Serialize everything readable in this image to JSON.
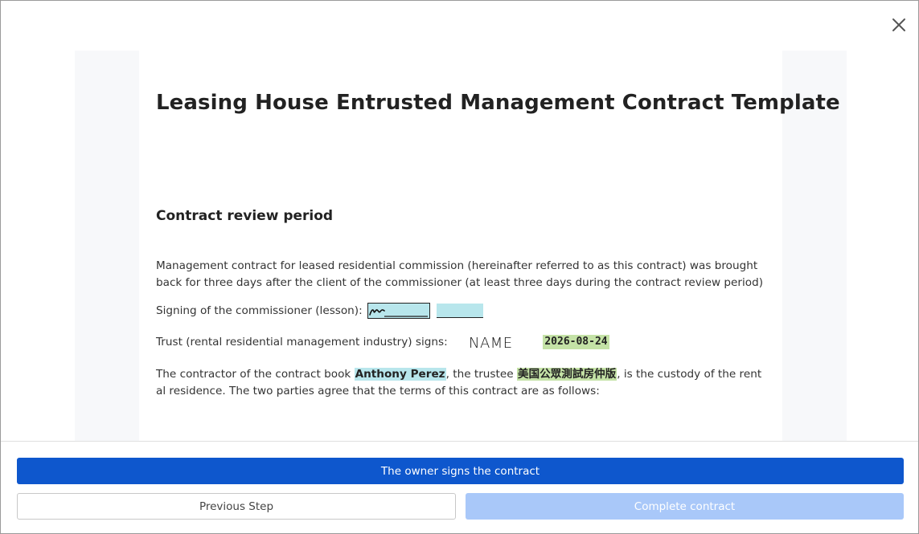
{
  "document": {
    "title": "Leasing House Entrusted Management Contract Template",
    "section_title": "Contract review period",
    "paragraph_1": "Management contract for leased residential commission (hereinafter referred to as this contract) was brought back for three days after the client of the commissioner (at least three days during the contract review period)",
    "signing_label": "Signing of the commissioner (lesson):",
    "trust_label": "Trust (rental residential management industry) signs:",
    "trust_name_signature": "NAME",
    "trust_date": "2026-08-24",
    "para4_prefix": "The contractor of the contract book ",
    "contractor_name": "Anthony Perez",
    "para4_middle": ", the trustee ",
    "trustee_name": "美国公眾測試房仲版",
    "para4_suffix": ", is the custody of the rental residence. The two parties agree that the terms of this contract are as follows:"
  },
  "footer": {
    "primary_label": "The owner signs the contract",
    "previous_label": "Previous Step",
    "complete_label": "Complete contract"
  },
  "colors": {
    "primary": "#0e57cd",
    "disabled": "#a9c8f9",
    "highlight_cyan": "#b8e6ec",
    "highlight_green": "#c4e2a6"
  }
}
